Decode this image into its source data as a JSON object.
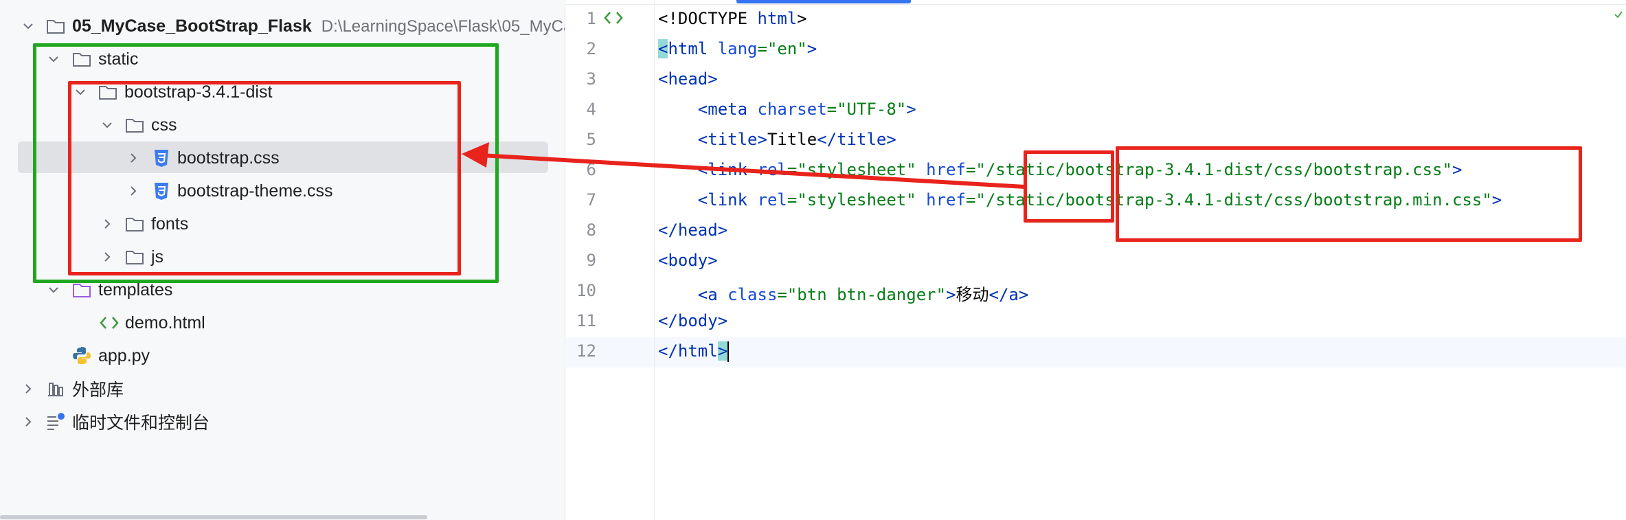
{
  "tree": {
    "root": {
      "name": "05_MyCase_BootStrap_Flask",
      "path": "D:\\LearningSpace\\Flask\\05_MyCa"
    },
    "items": [
      {
        "label": "static"
      },
      {
        "label": "bootstrap-3.4.1-dist"
      },
      {
        "label": "css"
      },
      {
        "label": "bootstrap.css"
      },
      {
        "label": "bootstrap-theme.css"
      },
      {
        "label": "fonts"
      },
      {
        "label": "js"
      },
      {
        "label": "templates"
      },
      {
        "label": "demo.html"
      },
      {
        "label": "app.py"
      },
      {
        "label": "外部库"
      },
      {
        "label": "临时文件和控制台"
      }
    ]
  },
  "editor": {
    "line_numbers": [
      "1",
      "2",
      "3",
      "4",
      "5",
      "6",
      "7",
      "8",
      "9",
      "10",
      "11",
      "12"
    ],
    "tokens": {
      "l1_doctype": "<!DOCTYPE",
      "l1_html": "html",
      "l1_close": ">",
      "l2_open": "<",
      "l2_tag": "html",
      "l2_attr": "lang",
      "l2_eq": "=",
      "l2_val": "\"en\"",
      "l2_close": ">",
      "l3": "<head>",
      "l4_open": "<meta",
      "l4_attr": "charset",
      "l4_eq": "=",
      "l4_val": "\"UTF-8\"",
      "l4_close": ">",
      "l5_open": "<title>",
      "l5_text": "Title",
      "l5_close": "</title>",
      "l6_open": "<link",
      "l6_attr1": "rel",
      "l6_val1": "\"stylesheet\"",
      "l6_attr2": "href",
      "l6_val2": "\"/static/bootstrap-3.4.1-dist/css/bootstrap.css\"",
      "l6_close": ">",
      "l7_open": "<link",
      "l7_attr1": "rel",
      "l7_val1": "\"stylesheet\"",
      "l7_attr2": "href",
      "l7_val2": "\"/static/bootstrap-3.4.1-dist/css/bootstrap.min.css\"",
      "l7_close": ">",
      "l8": "</head>",
      "l9": "<body>",
      "l10_open": "<a",
      "l10_attr": "class",
      "l10_val": "\"btn btn-danger\"",
      "l10_gt": ">",
      "l10_text": "移动",
      "l10_close": "</a>",
      "l11": "</body>",
      "l12_a": "</html",
      "l12_b": ">"
    }
  },
  "colors": {
    "tag": "#0033b3",
    "attr": "#174ad4",
    "string": "#067d17",
    "annotation_green": "#1fa81f",
    "annotation_red": "#e8231b",
    "selection": "#dfe1e5"
  },
  "icons": {
    "folder": "folder-icon",
    "css_file": "css-file-icon",
    "html_file": "html-file-icon",
    "python_file": "python-icon",
    "library": "library-icon",
    "scratches": "scratches-icon"
  }
}
